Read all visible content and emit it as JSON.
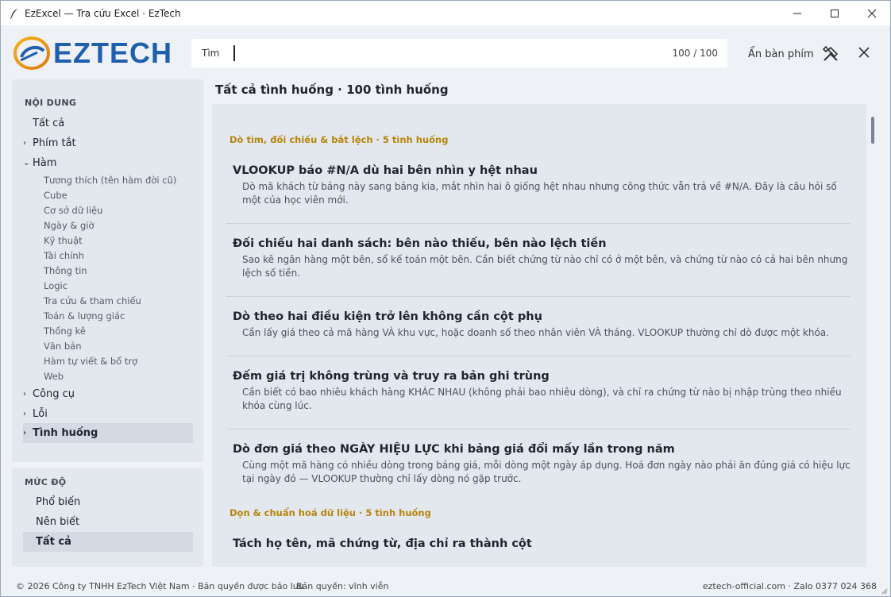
{
  "window": {
    "title": "EzExcel — Tra cứu Excel · EzTech",
    "accent": "#1f5fae"
  },
  "header": {
    "logo_text": "EZTECH",
    "search": {
      "label": "Tìm",
      "value": "",
      "count": "100 / 100"
    },
    "keyboard_toggle": "Ẩn bàn phím"
  },
  "sidebar": {
    "content_heading": "NỘI DUNG",
    "items": [
      {
        "label": "Tất cả",
        "chevron": ""
      },
      {
        "label": "Phím tắt",
        "chevron": "›"
      },
      {
        "label": "Hàm",
        "chevron": "⌄"
      },
      {
        "label": "Công cụ",
        "chevron": "›"
      },
      {
        "label": "Lỗi",
        "chevron": "›"
      },
      {
        "label": "Tình huống",
        "chevron": "›"
      }
    ],
    "sub_items": [
      "Tương thích (tên hàm đời cũ)",
      "Cube",
      "Cơ sở dữ liệu",
      "Ngày & giờ",
      "Kỹ thuật",
      "Tài chính",
      "Thông tin",
      "Logic",
      "Tra cứu & tham chiếu",
      "Toán & lượng giác",
      "Thống kê",
      "Văn bản",
      "Hàm tự viết & bổ trợ",
      "Web"
    ],
    "level_heading": "MỨC ĐỘ",
    "levels": [
      {
        "label": "Phổ biến"
      },
      {
        "label": "Nên biết"
      },
      {
        "label": "Tất cả"
      }
    ]
  },
  "main": {
    "title": "Tất cả tình huống  ·  100 tình huống",
    "categories": [
      {
        "label": "Dò tìm, đối chiếu & bắt lệch  ·  5 tình huống"
      },
      {
        "label": "Dọn & chuẩn hoá dữ liệu  ·  5 tình huống"
      }
    ],
    "cases": [
      {
        "title": "VLOOKUP báo #N/A dù hai bên nhìn y hệt nhau",
        "desc": "Dò mã khách từ bảng này sang bảng kia, mắt nhìn hai ô giống hệt nhau nhưng công thức vẫn trả về #N/A. Đây là câu hỏi số một của học viên mới."
      },
      {
        "title": "Đối chiếu hai danh sách: bên nào thiếu, bên nào lệch tiền",
        "desc": "Sao kê ngân hàng một bên, sổ kế toán một bên. Cần biết chứng từ nào chỉ có ở một bên, và chứng từ nào có cả hai bên nhưng lệch số tiền."
      },
      {
        "title": "Dò theo hai điều kiện trở lên không cần cột phụ",
        "desc": "Cần lấy giá theo cả mã hàng VÀ khu vực, hoặc doanh số theo nhân viên VÀ tháng. VLOOKUP thường chỉ dò được một khóa."
      },
      {
        "title": "Đếm giá trị không trùng và truy ra bản ghi trùng",
        "desc": "Cần biết có bao nhiêu khách hàng KHÁC NHAU (không phải bao nhiêu dòng), và chỉ ra chứng từ nào bị nhập trùng theo nhiều khóa cùng lúc."
      },
      {
        "title": "Dò đơn giá theo NGÀY HIỆU LỰC khi bảng giá đổi mấy lần trong năm",
        "desc": "Cùng một mã hàng có nhiều dòng trong bảng giá, mỗi dòng một ngày áp dụng. Hoá đơn ngày nào phải ăn đúng giá có hiệu lực tại ngày đó — VLOOKUP thường chỉ lấy dòng nó gặp trước."
      },
      {
        "title": "Tách họ tên, mã chứng từ, địa chỉ ra thành cột",
        "desc": ""
      }
    ]
  },
  "footer": {
    "copyright": "© 2026 Công ty TNHH EzTech Việt Nam · Bản quyền được bảo lưu",
    "license": "Bản quyền: vĩnh viễn",
    "contact": "eztech-official.com  ·  Zalo 0377 024 368"
  }
}
